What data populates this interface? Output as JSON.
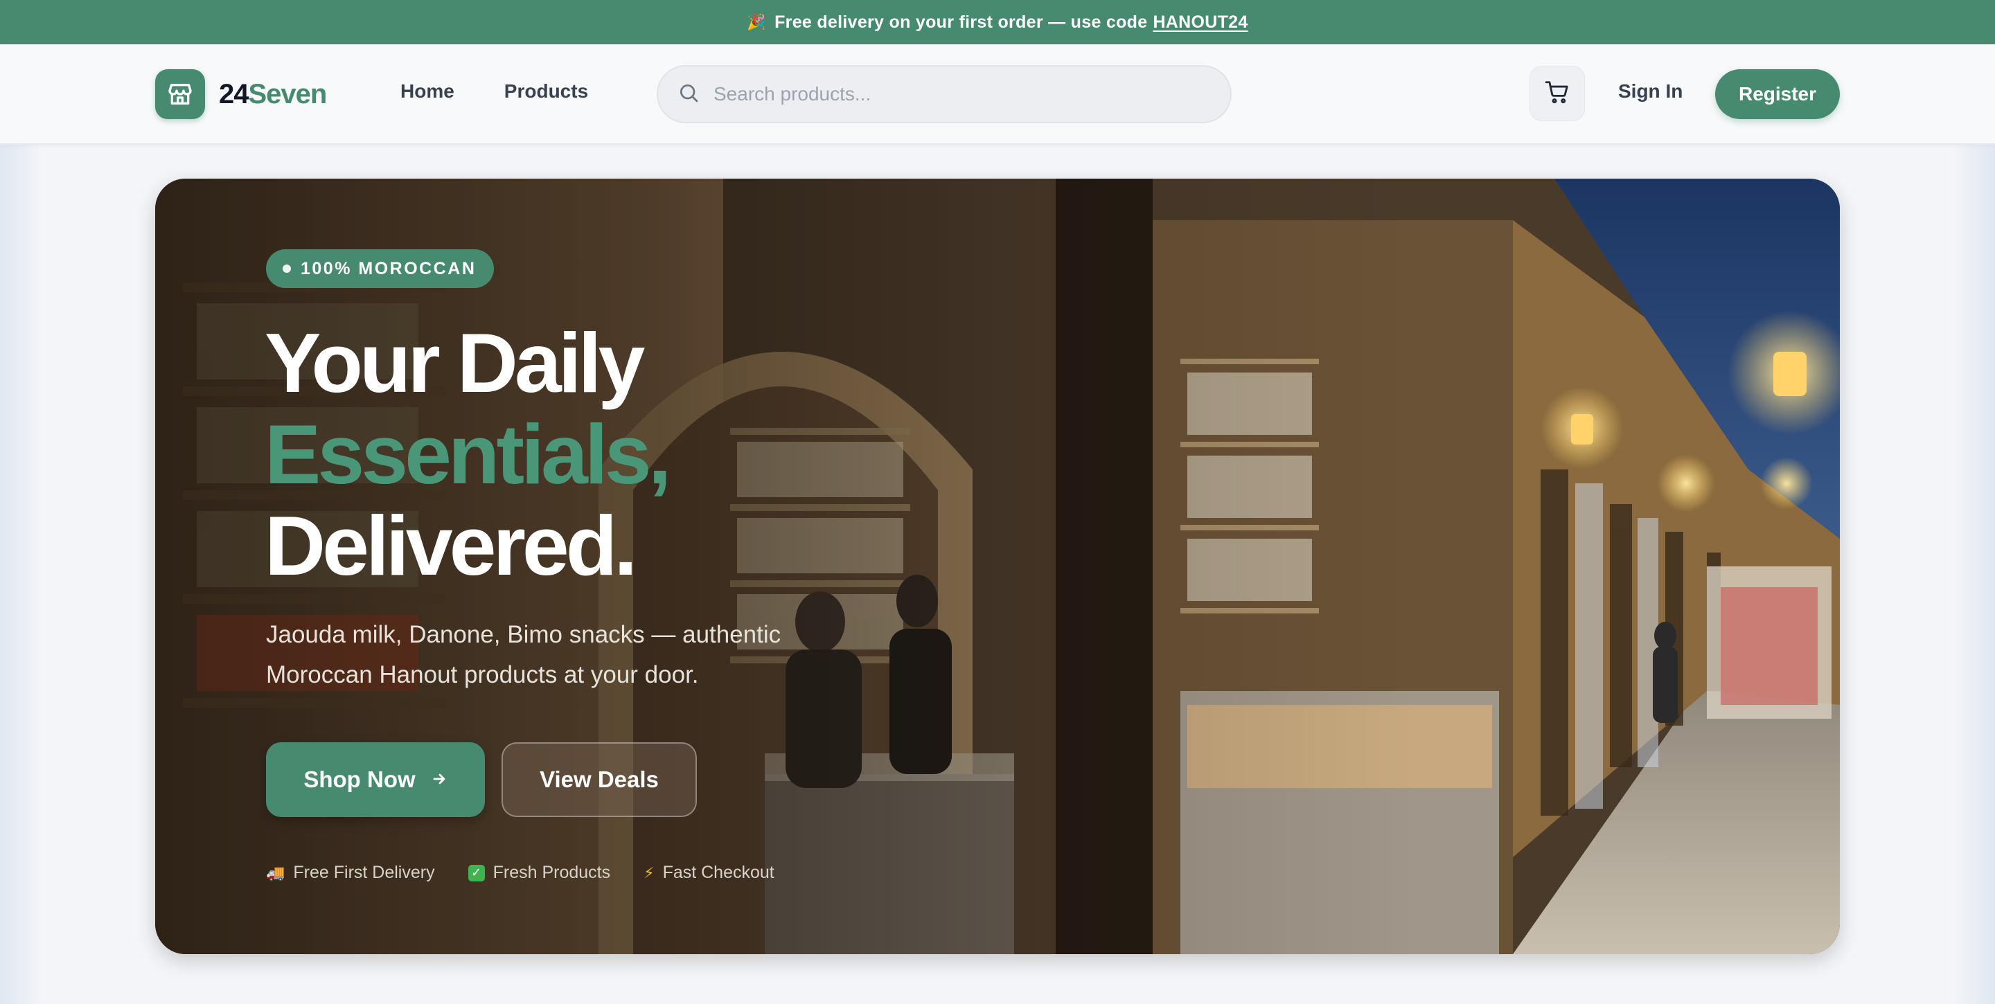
{
  "promo": {
    "emoji": "🎉",
    "text": "Free delivery on your first order — use code",
    "code": "HANOUT24"
  },
  "header": {
    "logo_part1": "24",
    "logo_part2": "Seven",
    "nav": [
      "Home",
      "Products"
    ],
    "search_placeholder": "Search products...",
    "signin_label": "Sign In",
    "register_label": "Register"
  },
  "hero": {
    "badge": "100% MOROCCAN",
    "headline": [
      "Your Daily",
      "Essentials,",
      "Delivered."
    ],
    "subtext": "Jaouda milk, Danone, Bimo snacks — authentic Moroccan Hanout products at your door.",
    "primary_cta": "Shop Now",
    "secondary_cta": "View Deals",
    "features": [
      {
        "icon": "truck-icon",
        "glyph": "🚚",
        "label": "Free First Delivery"
      },
      {
        "icon": "check-icon",
        "glyph": "✓",
        "label": "Fresh Products"
      },
      {
        "icon": "lightning-icon",
        "glyph": "⚡",
        "label": "Fast Checkout"
      }
    ]
  },
  "colors": {
    "brand": "#468a6f",
    "dark_text": "#111827",
    "nav_text": "#374151"
  }
}
